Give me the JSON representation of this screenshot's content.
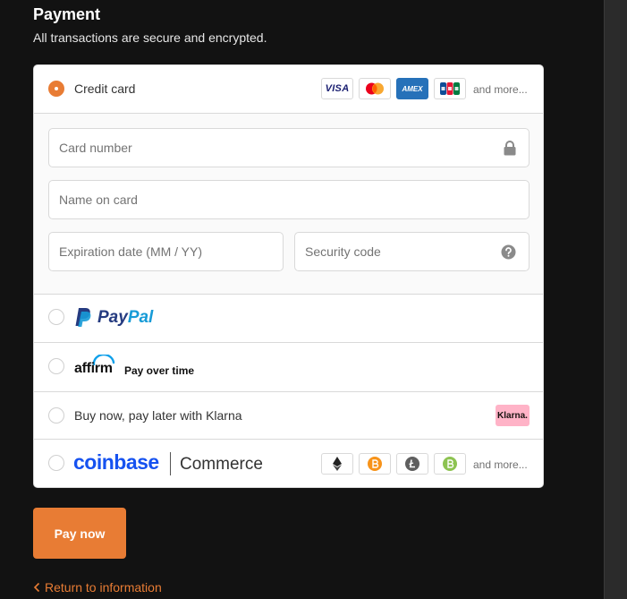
{
  "header": {
    "title": "Payment",
    "subtitle": "All transactions are secure and encrypted."
  },
  "credit_card": {
    "label": "Credit card",
    "selected": true,
    "brands": [
      "VISA",
      "AMEX"
    ],
    "more": "and more..."
  },
  "card_form": {
    "card_number_placeholder": "Card number",
    "name_placeholder": "Name on card",
    "expiry_placeholder": "Expiration date (MM / YY)",
    "security_placeholder": "Security code"
  },
  "paypal": {
    "logo_pay": "Pay",
    "logo_pal": "Pal"
  },
  "affirm": {
    "logo": "affirm",
    "text": "Pay over time"
  },
  "klarna": {
    "label": "Buy now, pay later with Klarna",
    "badge": "Klarna."
  },
  "coinbase": {
    "logo": "coinbase",
    "commerce": "Commerce",
    "more": "and more..."
  },
  "actions": {
    "pay_now": "Pay now",
    "return_link": "Return to information"
  },
  "colors": {
    "accent": "#e87c34",
    "paypal_dark": "#253b80",
    "paypal_light": "#179bd7",
    "coinbase_blue": "#1652f0",
    "klarna_pink": "#ffb3c7",
    "amex_blue": "#2671b9"
  }
}
